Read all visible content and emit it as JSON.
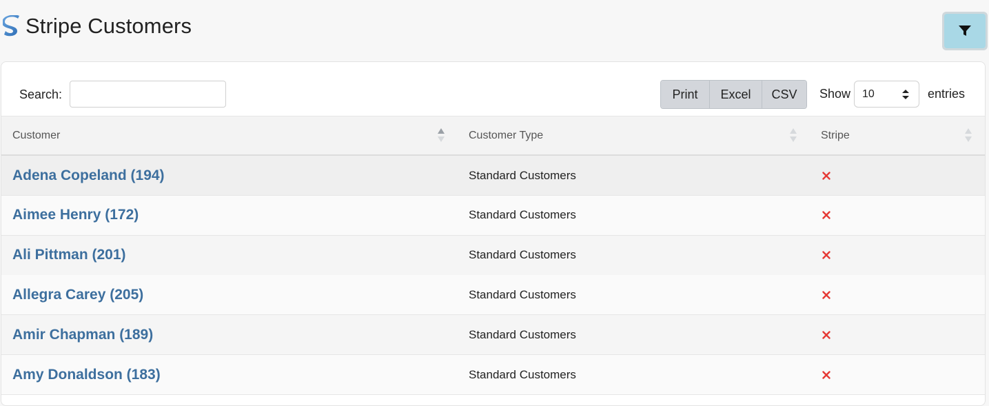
{
  "header": {
    "title": "Stripe Customers",
    "logo_icon": "stripe-s-logo",
    "filter_icon": "filter-funnel-icon"
  },
  "toolbar": {
    "search_label": "Search:",
    "search_value": "",
    "buttons": [
      "Print",
      "Excel",
      "CSV"
    ],
    "show_label": "Show",
    "show_value": "10",
    "entries_label": "entries"
  },
  "table": {
    "columns": [
      "Customer",
      "Customer Type",
      "Stripe"
    ],
    "rows": [
      {
        "customer": "Adena Copeland (194)",
        "type": "Standard Customers",
        "stripe": "x-icon"
      },
      {
        "customer": "Aimee Henry (172)",
        "type": "Standard Customers",
        "stripe": "x-icon"
      },
      {
        "customer": "Ali Pittman (201)",
        "type": "Standard Customers",
        "stripe": "x-icon"
      },
      {
        "customer": "Allegra Carey (205)",
        "type": "Standard Customers",
        "stripe": "x-icon"
      },
      {
        "customer": "Amir Chapman (189)",
        "type": "Standard Customers",
        "stripe": "x-icon"
      },
      {
        "customer": "Amy Donaldson (183)",
        "type": "Standard Customers",
        "stripe": "x-icon"
      }
    ]
  },
  "colors": {
    "link": "#3d6f9e",
    "x_mark": "#e53935",
    "filter_button": "#a9d8e6"
  }
}
